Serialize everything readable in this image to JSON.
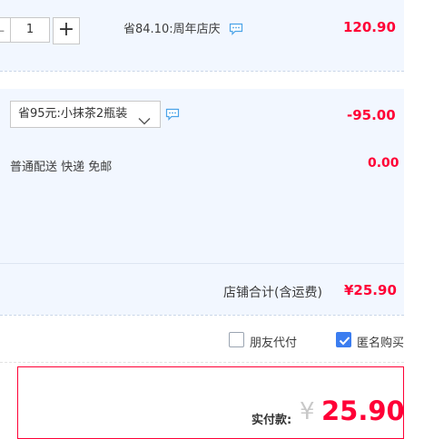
{
  "item": {
    "quantity_value": "1",
    "minus_label": "-",
    "plus_label": "+",
    "discount_text": "省84.10:周年店庆",
    "price": "120.90"
  },
  "promo": {
    "selected_option": "省95元:小抹茶2瓶装",
    "amount": "-95.00"
  },
  "shipping": {
    "text": "普通配送 快递 免邮",
    "amount": "0.00"
  },
  "shop_total": {
    "label": "店铺合计(含运费)",
    "value": "¥25.90"
  },
  "options": {
    "friend_pay_label": "朋友代付",
    "friend_pay_checked": false,
    "anonymous_label": "匿名购买",
    "anonymous_checked": true
  },
  "payment": {
    "label": "实付款:",
    "currency": "¥",
    "amount": "25.90"
  },
  "colors": {
    "accent_red": "#ff0036",
    "row_background": "#f2f7ff",
    "checkbox_blue": "#3b7df0",
    "chat_icon": "#4aa3e8"
  }
}
